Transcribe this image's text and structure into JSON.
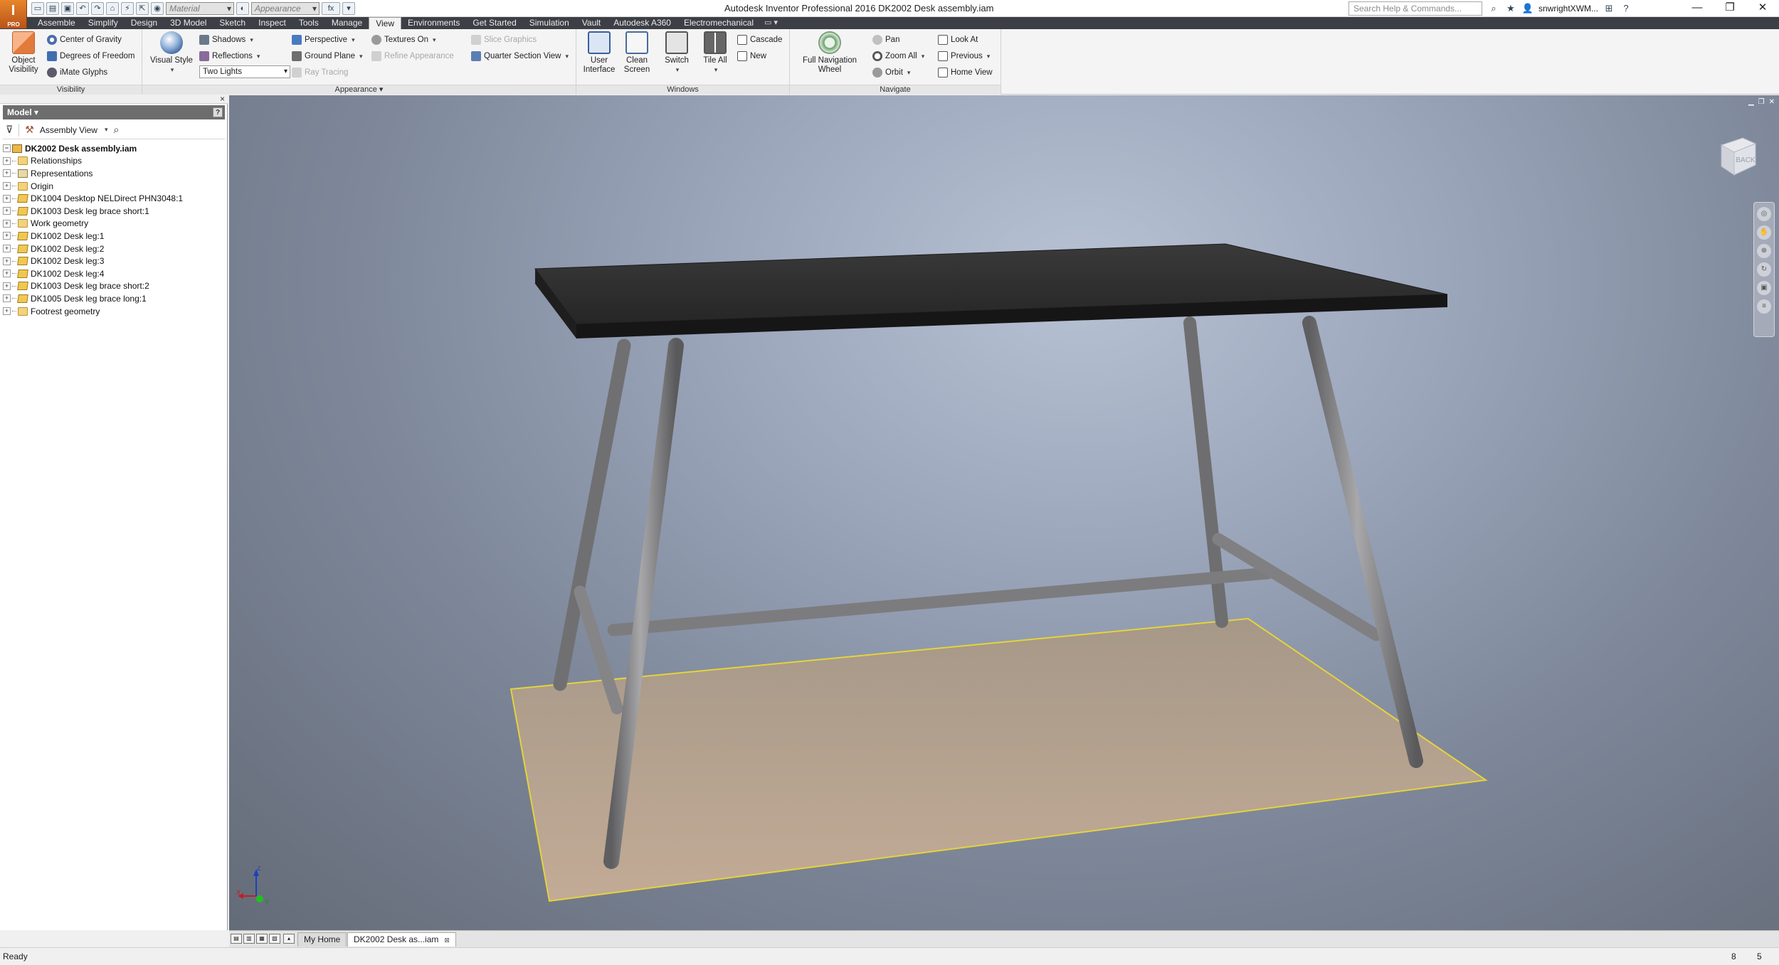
{
  "titlebar": {
    "app_badge": "I",
    "app_badge_sub": "PRO",
    "title": "Autodesk Inventor Professional 2016   DK2002 Desk assembly.iam",
    "material_combo": "Material",
    "appearance_combo": "Appearance",
    "fx_label": "fx",
    "search_placeholder": "Search Help & Commands...",
    "user": "snwrightXWM...",
    "help": "?",
    "minimize": "—",
    "restore": "❐",
    "close": "✕"
  },
  "tabs": [
    "Assemble",
    "Simplify",
    "Design",
    "3D Model",
    "Sketch",
    "Inspect",
    "Tools",
    "Manage",
    "View",
    "Environments",
    "Get Started",
    "Simulation",
    "Vault",
    "Autodesk A360",
    "Electromechanical"
  ],
  "active_tab": "View",
  "tabs_extra": "▭ ▾",
  "ribbon": {
    "visibility": {
      "title": "Visibility",
      "object_visibility": "Object Visibility",
      "object_visibility_l1": "Object",
      "object_visibility_l2": "Visibility",
      "center_of_gravity": "Center of Gravity",
      "degrees_of_freedom": "Degrees of Freedom",
      "imate_glyphs": "iMate Glyphs"
    },
    "appearance": {
      "title": "Appearance",
      "visual_style": "Visual Style",
      "shadows": "Shadows",
      "reflections": "Reflections",
      "lighting_value": "Two Lights",
      "perspective": "Perspective",
      "ground_plane": "Ground Plane",
      "ray_tracing": "Ray Tracing",
      "textures_on": "Textures On",
      "refine_appearance": "Refine Appearance",
      "slice_graphics": "Slice Graphics",
      "quarter_section_view": "Quarter Section View"
    },
    "windows": {
      "title": "Windows",
      "user_interface_l1": "User",
      "user_interface_l2": "Interface",
      "clean_screen_l1": "Clean",
      "clean_screen_l2": "Screen",
      "switch": "Switch",
      "tile_all": "Tile All",
      "cascade": "Cascade",
      "new": "New"
    },
    "navigate": {
      "title": "Navigate",
      "full_nav_l1": "Full Navigation",
      "full_nav_l2": "Wheel",
      "pan": "Pan",
      "zoom_all": "Zoom All",
      "orbit": "Orbit",
      "look_at": "Look At",
      "previous": "Previous",
      "home_view": "Home View"
    }
  },
  "browser": {
    "header": "Model ▾",
    "help": "?",
    "close": "×",
    "view_combo": "Assembly View",
    "tree": [
      {
        "label": "DK2002 Desk assembly.iam",
        "icon": "asm",
        "root": true
      },
      {
        "label": "Relationships",
        "icon": "folder"
      },
      {
        "label": "Representations",
        "icon": "rep"
      },
      {
        "label": "Origin",
        "icon": "folder"
      },
      {
        "label": "DK1004 Desktop NELDirect PHN3048:1",
        "icon": "part"
      },
      {
        "label": "DK1003 Desk leg brace short:1",
        "icon": "part"
      },
      {
        "label": "Work geometry",
        "icon": "folder"
      },
      {
        "label": "DK1002 Desk leg:1",
        "icon": "part"
      },
      {
        "label": "DK1002 Desk leg:2",
        "icon": "part"
      },
      {
        "label": "DK1002 Desk leg:3",
        "icon": "part"
      },
      {
        "label": "DK1002 Desk leg:4",
        "icon": "part"
      },
      {
        "label": "DK1003 Desk leg brace short:2",
        "icon": "part"
      },
      {
        "label": "DK1005 Desk leg brace long:1",
        "icon": "part"
      },
      {
        "label": "Footrest geometry",
        "icon": "folder"
      }
    ]
  },
  "viewport": {
    "viewcube_face": "BACK",
    "triad": {
      "x": "X",
      "y": "Y",
      "z": "Z"
    },
    "colors": {
      "desktop": "#2b2b2b",
      "legs": "#8a8a8c",
      "ground": "#b8a08a",
      "ground_edge": "#e8d63a"
    }
  },
  "doc_tabs": {
    "my_home": "My Home",
    "document": "DK2002 Desk as...iam",
    "close": "⊠"
  },
  "status": {
    "text": "Ready",
    "n1": "8",
    "n2": "5"
  }
}
